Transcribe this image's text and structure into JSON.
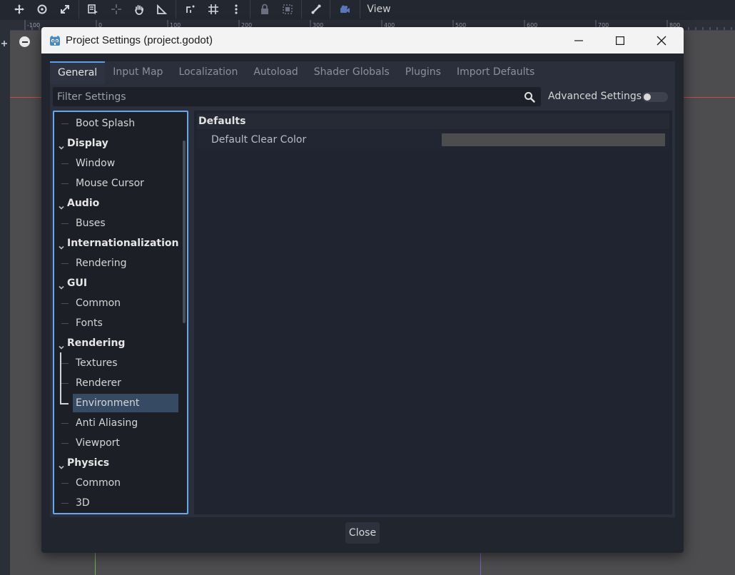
{
  "editor": {
    "toolbar_icons": [
      "move-icon",
      "rotate-icon",
      "scale-icon",
      "select-list-icon",
      "pivot-icon",
      "pan-icon",
      "ruler-icon",
      "smart-snap-icon",
      "grid-snap-icon",
      "more-icon",
      "lock-icon",
      "group-icon",
      "bone-icon",
      "camera-icon"
    ],
    "view_menu": "View",
    "ruler_labels": [
      "-100",
      "0",
      "100",
      "200",
      "300",
      "400",
      "500",
      "600",
      "700",
      "800"
    ]
  },
  "dialog": {
    "title": "Project Settings (project.godot)",
    "tabs": [
      {
        "label": "General",
        "active": true
      },
      {
        "label": "Input Map",
        "active": false
      },
      {
        "label": "Localization",
        "active": false
      },
      {
        "label": "Autoload",
        "active": false
      },
      {
        "label": "Shader Globals",
        "active": false
      },
      {
        "label": "Plugins",
        "active": false
      },
      {
        "label": "Import Defaults",
        "active": false
      }
    ],
    "filter": {
      "placeholder": "Filter Settings",
      "value": ""
    },
    "advanced_settings": {
      "label": "Advanced Settings",
      "enabled": false
    },
    "tree": {
      "items": [
        {
          "label": "Boot Splash",
          "section": false
        },
        {
          "label": "Display",
          "section": true
        },
        {
          "label": "Window",
          "section": false
        },
        {
          "label": "Mouse Cursor",
          "section": false
        },
        {
          "label": "Audio",
          "section": true
        },
        {
          "label": "Buses",
          "section": false
        },
        {
          "label": "Internationalization",
          "section": true
        },
        {
          "label": "Rendering",
          "section": false
        },
        {
          "label": "GUI",
          "section": true
        },
        {
          "label": "Common",
          "section": false
        },
        {
          "label": "Fonts",
          "section": false
        },
        {
          "label": "Rendering",
          "section": true
        },
        {
          "label": "Textures",
          "section": false
        },
        {
          "label": "Renderer",
          "section": false
        },
        {
          "label": "Environment",
          "section": false,
          "selected": true
        },
        {
          "label": "Anti Aliasing",
          "section": false
        },
        {
          "label": "Viewport",
          "section": false
        },
        {
          "label": "Physics",
          "section": true
        },
        {
          "label": "Common",
          "section": false
        },
        {
          "label": "3D",
          "section": false
        }
      ]
    },
    "inspector": {
      "section_title": "Defaults",
      "properties": [
        {
          "label": "Default Clear Color",
          "value_color": "#4d4d4d"
        }
      ]
    },
    "close_label": "Close"
  },
  "colors": {
    "accent": "#66a8ee",
    "selection": "#364a63",
    "panel": "#21252e"
  }
}
